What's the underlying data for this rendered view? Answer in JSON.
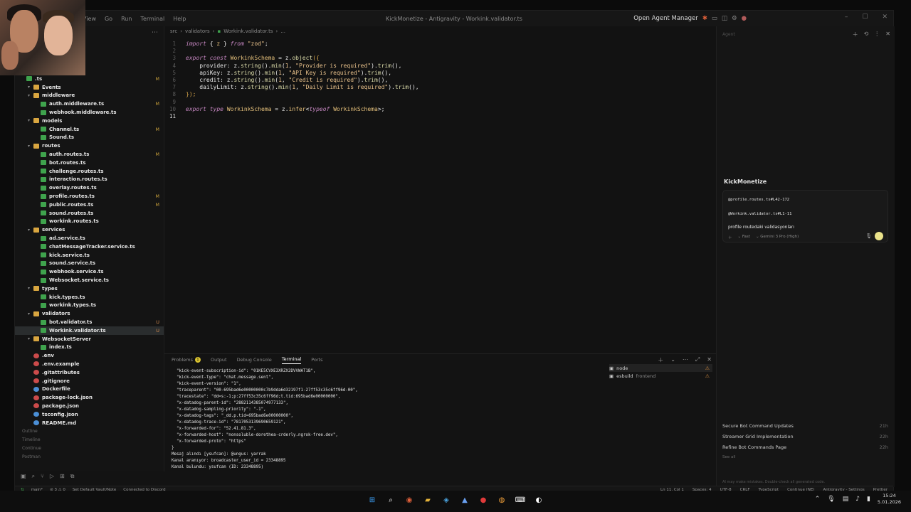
{
  "titlebar": {
    "menu": [
      "View",
      "Go",
      "Run",
      "Terminal",
      "Help"
    ],
    "title": "KickMonetize - Antigravity - Workink.validator.ts",
    "open_agent_manager": "Open Agent Manager"
  },
  "sidebar": {
    "tree": [
      {
        "type": "file",
        "name": ".ts",
        "indent": 0,
        "status": "M",
        "kind": "ts"
      },
      {
        "type": "folder",
        "name": "Events",
        "indent": 1,
        "status": ""
      },
      {
        "type": "folder",
        "name": "middleware",
        "indent": 1,
        "status": ""
      },
      {
        "type": "file",
        "name": "auth.middleware.ts",
        "indent": 2,
        "status": "M",
        "kind": "ts"
      },
      {
        "type": "file",
        "name": "webhook.middleware.ts",
        "indent": 2,
        "status": "",
        "kind": "ts"
      },
      {
        "type": "folder",
        "name": "models",
        "indent": 1,
        "status": ""
      },
      {
        "type": "file",
        "name": "Channel.ts",
        "indent": 2,
        "status": "M",
        "kind": "ts"
      },
      {
        "type": "file",
        "name": "Sound.ts",
        "indent": 2,
        "status": "",
        "kind": "ts"
      },
      {
        "type": "folder",
        "name": "routes",
        "indent": 1,
        "status": ""
      },
      {
        "type": "file",
        "name": "auth.routes.ts",
        "indent": 2,
        "status": "M",
        "kind": "ts"
      },
      {
        "type": "file",
        "name": "bot.routes.ts",
        "indent": 2,
        "status": "",
        "kind": "ts"
      },
      {
        "type": "file",
        "name": "challenge.routes.ts",
        "indent": 2,
        "status": "",
        "kind": "ts"
      },
      {
        "type": "file",
        "name": "interaction.routes.ts",
        "indent": 2,
        "status": "",
        "kind": "ts"
      },
      {
        "type": "file",
        "name": "overlay.routes.ts",
        "indent": 2,
        "status": "",
        "kind": "ts"
      },
      {
        "type": "file",
        "name": "profile.routes.ts",
        "indent": 2,
        "status": "M",
        "kind": "ts"
      },
      {
        "type": "file",
        "name": "public.routes.ts",
        "indent": 2,
        "status": "M",
        "kind": "ts"
      },
      {
        "type": "file",
        "name": "sound.routes.ts",
        "indent": 2,
        "status": "",
        "kind": "ts"
      },
      {
        "type": "file",
        "name": "workink.routes.ts",
        "indent": 2,
        "status": "",
        "kind": "ts"
      },
      {
        "type": "folder",
        "name": "services",
        "indent": 1,
        "status": ""
      },
      {
        "type": "file",
        "name": "ad.service.ts",
        "indent": 2,
        "status": "",
        "kind": "ts"
      },
      {
        "type": "file",
        "name": "chatMessageTracker.service.ts",
        "indent": 2,
        "status": "",
        "kind": "ts"
      },
      {
        "type": "file",
        "name": "kick.service.ts",
        "indent": 2,
        "status": "",
        "kind": "ts"
      },
      {
        "type": "file",
        "name": "sound.service.ts",
        "indent": 2,
        "status": "",
        "kind": "ts"
      },
      {
        "type": "file",
        "name": "webhook.service.ts",
        "indent": 2,
        "status": "",
        "kind": "ts"
      },
      {
        "type": "file",
        "name": "Websocket.service.ts",
        "indent": 2,
        "status": "",
        "kind": "ts"
      },
      {
        "type": "folder",
        "name": "types",
        "indent": 1,
        "status": ""
      },
      {
        "type": "file",
        "name": "kick.types.ts",
        "indent": 2,
        "status": "",
        "kind": "ts"
      },
      {
        "type": "file",
        "name": "workink.types.ts",
        "indent": 2,
        "status": "",
        "kind": "ts"
      },
      {
        "type": "folder",
        "name": "validators",
        "indent": 1,
        "status": ""
      },
      {
        "type": "file",
        "name": "bot.validator.ts",
        "indent": 2,
        "status": "U",
        "kind": "ts"
      },
      {
        "type": "file",
        "name": "Workink.validator.ts",
        "indent": 2,
        "status": "U",
        "kind": "ts",
        "selected": true
      },
      {
        "type": "folder",
        "name": "WebsocketServer",
        "indent": 1,
        "status": ""
      },
      {
        "type": "file",
        "name": "index.ts",
        "indent": 2,
        "status": "",
        "kind": "ts"
      },
      {
        "type": "file",
        "name": ".env",
        "indent": 1,
        "status": "",
        "kind": "other"
      },
      {
        "type": "file",
        "name": ".env.example",
        "indent": 1,
        "status": "",
        "kind": "other"
      },
      {
        "type": "file",
        "name": ".gitattributes",
        "indent": 1,
        "status": "",
        "kind": "other"
      },
      {
        "type": "file",
        "name": ".gitignore",
        "indent": 1,
        "status": "",
        "kind": "other"
      },
      {
        "type": "file",
        "name": "Dockerfile",
        "indent": 1,
        "status": "",
        "kind": "blue"
      },
      {
        "type": "file",
        "name": "package-lock.json",
        "indent": 1,
        "status": "",
        "kind": "other"
      },
      {
        "type": "file",
        "name": "package.json",
        "indent": 1,
        "status": "",
        "kind": "other"
      },
      {
        "type": "file",
        "name": "tsconfig.json",
        "indent": 1,
        "status": "",
        "kind": "blue"
      },
      {
        "type": "file",
        "name": "README.md",
        "indent": 1,
        "status": "",
        "kind": "blue"
      }
    ],
    "sections": [
      "Outline",
      "Timeline",
      "Continue",
      "Postman"
    ]
  },
  "editor": {
    "breadcrumb": [
      "src",
      "validators",
      "Workink.validator.ts",
      "..."
    ],
    "current_line": "11"
  },
  "panel": {
    "tabs": [
      "Problems",
      "Output",
      "Debug Console",
      "Terminal",
      "Ports"
    ],
    "problems_count": "1",
    "terminal_lines": [
      "  \"kick-event-subscription-id\": \"01KE5CVXE3XRZX2DVVWAT1B\",",
      "  \"kick-event-type\": \"chat.message.sent\",",
      "  \"kick-event-version\": \"1\",",
      "  \"traceparent\": \"00-695bad6e00000000c7b9dda6d32197f1-27ff53c35c6ff96d-00\",",
      "  \"tracestate\": \"dd=s:-1;p:27ff53c35c6ff96d;t.tid:695bad6e00000000\",",
      "  \"x-datadog-parent-id\": \"2882114385074977133\",",
      "  \"x-datadog-sampling-priority\": \"-1\",",
      "  \"x-datadog-tags\": \"_dd.p.tid=695bad6e00000000\",",
      "  \"x-datadog-trace-id\": \"7817053139690659121\",",
      "  \"x-forwarded-for\": \"52.41.81.3\",",
      "  \"x-forwarded-host\": \"nonsoluble-dorethea-crderly.ngrok-free.dev\",",
      "  \"x-forwarded-proto\": \"https\"",
      "}",
      "Mesaj alındı [ysufcan]: @ungus: yarrak",
      "Kanal aranıyor: broadcaster_user_id = 23348895",
      "Kanal bulundu: ysufcan (ID: 23348895)"
    ],
    "terminals": [
      {
        "name": "node",
        "sub": ""
      },
      {
        "name": "esbuild",
        "sub": "frontend"
      }
    ]
  },
  "agent": {
    "header": "Agent",
    "project": "KickMonetize",
    "refs": [
      "@profile.routes.ts#L42-172",
      "@Workink.validator.ts#L1-11"
    ],
    "message": "profile routedaki validasyonları",
    "mode": "Fast",
    "model": "Gemini 3 Pro (High)",
    "conversations": [
      {
        "title": "Secure Bot Command Updates",
        "ago": "21h"
      },
      {
        "title": "Streamer Grid Implementation",
        "ago": "22h"
      },
      {
        "title": "Refine Bot Commands Page",
        "ago": "22h"
      }
    ],
    "see_all": "See all",
    "disclaimer": "AI may make mistakes. Double-check all generated code."
  },
  "statusbar": {
    "branch": "main*",
    "sync": "⊘ 3 ⚠ 0",
    "vault": "Set Default Vault/Note",
    "discord": "Connected to Discord",
    "position": "Ln 11, Col 1",
    "spaces": "Spaces: 4",
    "encoding": "UTF-8",
    "eol": "CRLF",
    "language": "TypeScript",
    "continue": "Continue (NE)",
    "settings": "Antigravity - Settings",
    "prettier": "Prettier"
  },
  "taskbar": {
    "time": "15:24",
    "date": "5.01.2026"
  }
}
